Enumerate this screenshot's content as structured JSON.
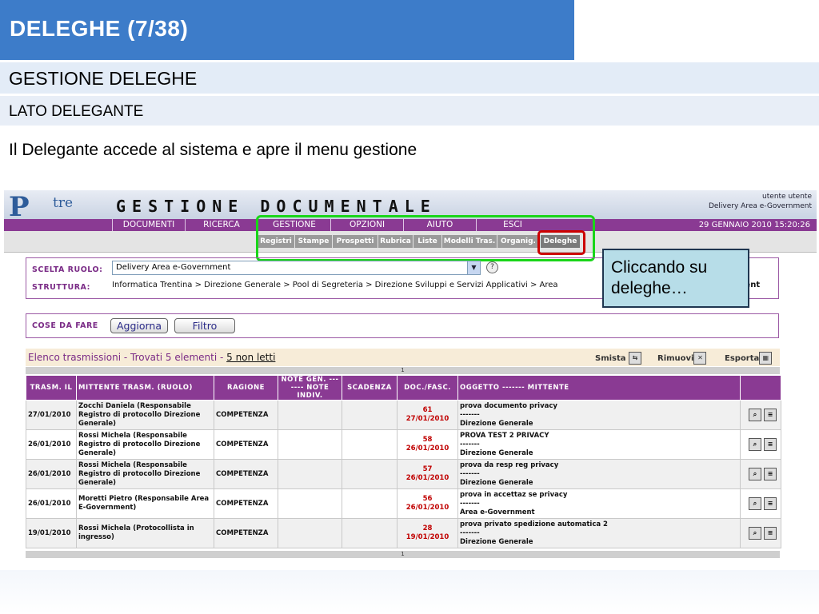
{
  "slide": {
    "title": "DELEGHE (7/38)",
    "subtitle1": "GESTIONE DELEGHE",
    "subtitle2": "LATO DELEGANTE",
    "intro": "Il Delegante accede al sistema e apre il menu gestione"
  },
  "callout": {
    "text": "Cliccando su deleghe…"
  },
  "app": {
    "logo_text": "tre",
    "title": "GESTIONE DOCUMENTALE",
    "user_label": "utente utente",
    "user_area": "Delivery Area e-Government",
    "date": "29 GENNAIO 2010 15:20:26",
    "menu": [
      "DOCUMENTI",
      "RICERCA",
      "GESTIONE",
      "OPZIONI",
      "AIUTO",
      "ESCI"
    ],
    "submenu": [
      "Registri",
      "Stampe",
      "Prospetti",
      "Rubrica",
      "Liste",
      "Modelli Tras.",
      "Organig.",
      "Deleghe"
    ]
  },
  "role": {
    "label": "SCELTA RUOLO:",
    "value": "Delivery Area e-Government",
    "help": "?",
    "structure_label": "STRUTTURA:",
    "structure_value": "Informatica Trentina > Direzione Generale > Pool di Segreteria > Direzione Sviluppi e Servizi Applicativi > Area",
    "structure_end": "ment"
  },
  "todo": {
    "label": "COSE DA FARE",
    "refresh_button": "Aggiorna",
    "filter_button": "Filtro"
  },
  "list": {
    "title": "Elenco trasmissioni - Trovati 5 elementi - ",
    "unread_link": "5 non letti",
    "actions": [
      "Smista",
      "Rimuovi",
      "Esporta"
    ],
    "page": "1",
    "columns": [
      "TRASM. IL",
      "MITTENTE TRASM. (RUOLO)",
      "RAGIONE",
      "NOTE GEN. ------- NOTE INDIV.",
      "SCADENZA",
      "DOC./FASC.",
      "OGGETTO ------- MITTENTE",
      ""
    ],
    "rows": [
      {
        "date": "27/01/2010",
        "sender": "Zocchi Daniela (Responsabile Registro di protocollo Direzione Generale)",
        "reason": "COMPETENZA",
        "doc": "61",
        "doc_date": "27/01/2010",
        "subject": "prova documento privacy",
        "dash": "-------",
        "origin": "Direzione Generale"
      },
      {
        "date": "26/01/2010",
        "sender": "Rossi Michela (Responsabile Registro di protocollo Direzione Generale)",
        "reason": "COMPETENZA",
        "doc": "58",
        "doc_date": "26/01/2010",
        "subject": "PROVA TEST 2 PRIVACY",
        "dash": "-------",
        "origin": "Direzione Generale"
      },
      {
        "date": "26/01/2010",
        "sender": "Rossi Michela (Responsabile Registro di protocollo Direzione Generale)",
        "reason": "COMPETENZA",
        "doc": "57",
        "doc_date": "26/01/2010",
        "subject": "prova da resp reg privacy",
        "dash": "-------",
        "origin": "Direzione Generale"
      },
      {
        "date": "26/01/2010",
        "sender": "Moretti Pietro (Responsabile Area E-Government)",
        "reason": "COMPETENZA",
        "doc": "56",
        "doc_date": "26/01/2010",
        "subject": "prova in accettaz se privacy",
        "dash": "-------",
        "origin": "Area e-Government"
      },
      {
        "date": "19/01/2010",
        "sender": "Rossi Michela (Protocollista in ingresso)",
        "reason": "COMPETENZA",
        "doc": "28",
        "doc_date": "19/01/2010",
        "subject": "prova privato spedizione automatica 2",
        "dash": "-------",
        "origin": "Direzione Generale"
      }
    ]
  },
  "colors": {
    "title_bg": "#3d7cc9",
    "menu_purple": "#8a3a93",
    "highlight_green": "#19d619",
    "highlight_red": "#cc0000",
    "callout_bg": "#b7dde8"
  }
}
